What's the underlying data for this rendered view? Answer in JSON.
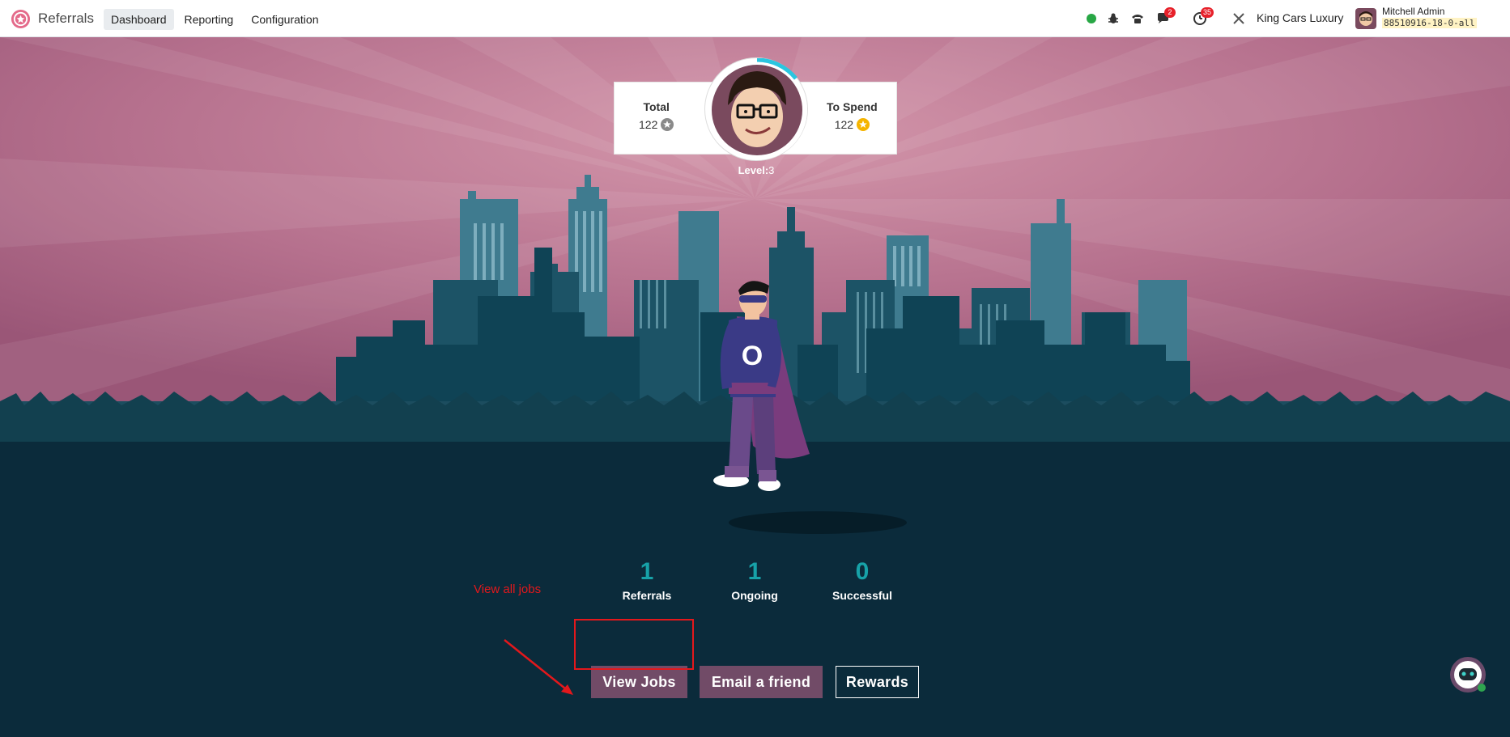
{
  "navbar": {
    "app_name": "Referrals",
    "menu": [
      "Dashboard",
      "Reporting",
      "Configuration"
    ],
    "active_menu": "Dashboard",
    "messages_badge": "2",
    "activities_badge": "35",
    "company": "King Cars Luxury",
    "user_name": "Mitchell Admin",
    "database": "88510916-18-0-all"
  },
  "points": {
    "total_label": "Total",
    "total_value": "122",
    "spend_label": "To Spend",
    "spend_value": "122",
    "level_label": "Level:",
    "level_value": "3"
  },
  "counters": [
    {
      "value": "1",
      "label": "Referrals"
    },
    {
      "value": "1",
      "label": "Ongoing"
    },
    {
      "value": "0",
      "label": "Successful"
    }
  ],
  "actions": {
    "view_jobs": "View Jobs",
    "email_friend": "Email a friend",
    "rewards": "Rewards"
  },
  "annotation": {
    "text": "View all jobs",
    "color": "#e3181c"
  },
  "colors": {
    "brand": "#714b67",
    "accent": "#17a2a8",
    "sky": "#b56a8a",
    "ground": "#0b2b3b"
  },
  "icons": [
    "presence-online-icon",
    "bug-icon",
    "phone-icon",
    "messages-icon",
    "activity-clock-icon",
    "settings-tools-icon"
  ]
}
